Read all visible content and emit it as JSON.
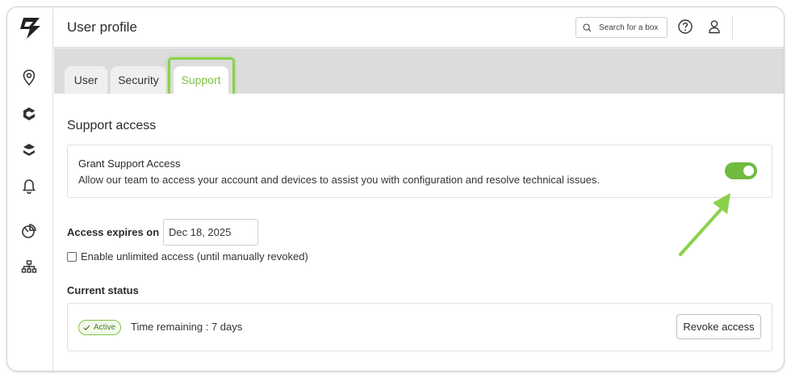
{
  "header": {
    "title": "User profile",
    "search_placeholder": "Search for a box",
    "help_icon": "question-circle-icon",
    "user_icon": "user-icon"
  },
  "sidebar": {
    "logo": "brand-logo",
    "icons": [
      "location-pin-icon",
      "cube-icon",
      "layers-icon",
      "bell-icon",
      "pie-chart-icon",
      "network-icon"
    ]
  },
  "tabs": [
    {
      "label": "User",
      "active": false
    },
    {
      "label": "Security",
      "active": false
    },
    {
      "label": "Support",
      "active": true
    }
  ],
  "support": {
    "section_title": "Support access",
    "grant_title": "Grant Support Access",
    "grant_description": "Allow our team to access your account and devices to assist you with configuration and resolve technical issues.",
    "grant_enabled": true,
    "expires_label": "Access expires on",
    "expires_value": "Dec 18, 2025",
    "unlimited_label": "Enable unlimited access (until manually revoked)",
    "unlimited_checked": false,
    "status_title": "Current status",
    "status_badge": "Active",
    "time_remaining": "Time remaining : 7 days",
    "revoke_label": "Revoke access"
  },
  "colors": {
    "accent": "#7dc242",
    "toggle_on": "#6fba3f",
    "highlight": "#8bd14a"
  }
}
